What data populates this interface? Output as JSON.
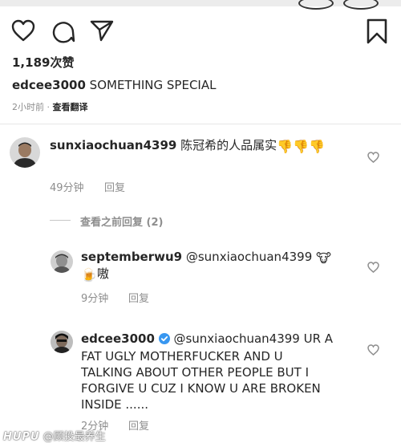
{
  "post": {
    "likes": "1,189次赞",
    "author": "edcee3000",
    "caption_text": " SOMETHING SPECIAL",
    "time": "2小时前 · ",
    "see_translation": "查看翻译"
  },
  "comments": [
    {
      "username": "sunxiaochuan4399",
      "text": " 陈冠希的人品属实",
      "emoji": "👎",
      "time": "49分钟",
      "reply": "回复"
    }
  ],
  "view_previous_replies": "查看之前回复 (2)",
  "replies": [
    {
      "username": "septemberwu9",
      "mention": " @sunxiaochuan4399",
      "emoji_1": "🐮",
      "emoji_2": "🍺",
      "text": "嗷",
      "time": "9分钟",
      "reply": "回复"
    },
    {
      "username": "edcee3000",
      "mention": " @sunxiaochuan4399",
      "text_line1": " UR A",
      "text_line2": "FAT UGLY MOTHERFUCKER AND U",
      "text_line3": "TALKING ABOUT OTHER PEOPLE BUT I",
      "text_line4": "FORGIVE U CUZ I KNOW U ARE BROKEN",
      "text_line5": "INSIDE ......",
      "time": "2分钟",
      "reply": "回复",
      "verified": true
    }
  ],
  "watermark": {
    "brand": "HUPU",
    "handle": "@顾投最养生"
  },
  "colors": {
    "verified_badge": "#3897f0",
    "secondary_text": "#8e8e8e",
    "primary_text": "#262626"
  },
  "icons": [
    "heart-icon",
    "comment-icon",
    "share-icon",
    "bookmark-icon",
    "like-comment-icon",
    "verified-badge-icon"
  ]
}
